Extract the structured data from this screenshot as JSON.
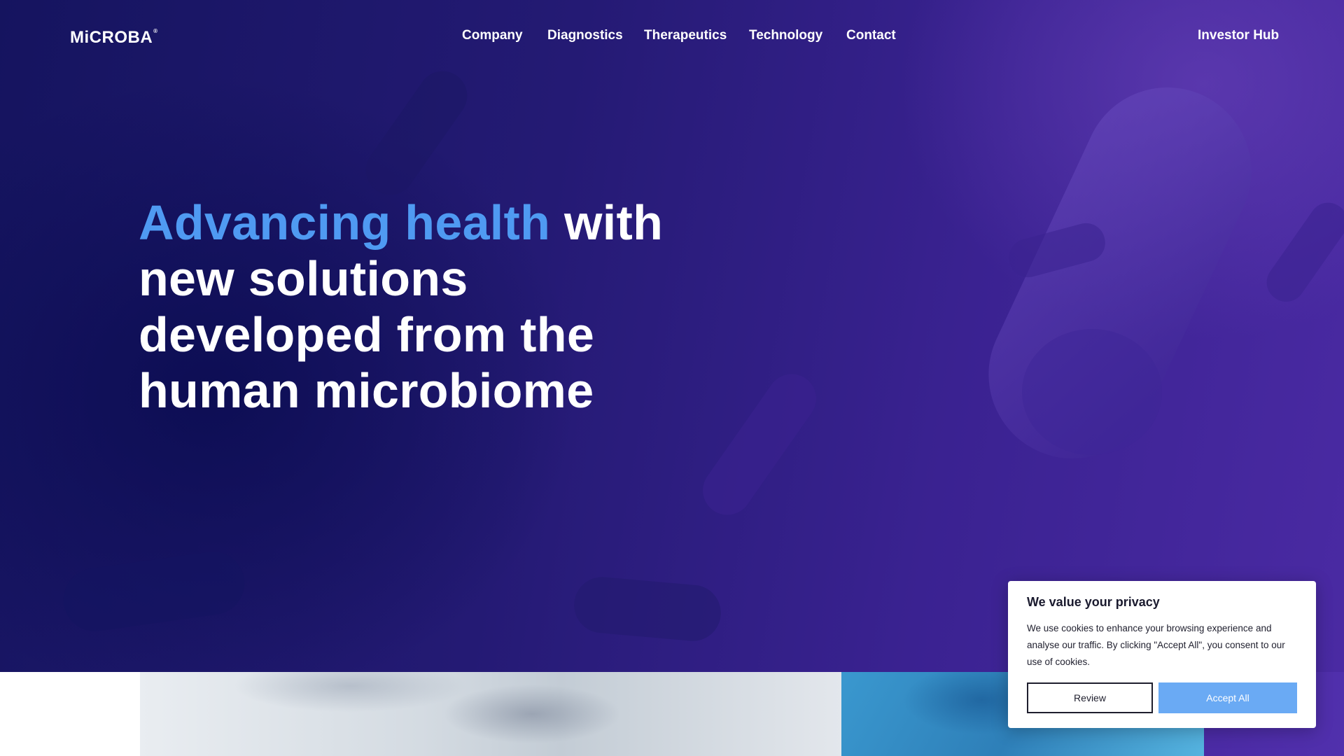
{
  "brand": {
    "logo_text": "MiCROBA",
    "logo_mark": "®"
  },
  "nav": {
    "items": [
      {
        "label": "Company"
      },
      {
        "label": "Diagnostics"
      },
      {
        "label": "Therapeutics"
      },
      {
        "label": "Technology"
      },
      {
        "label": "Contact"
      }
    ],
    "investor_hub": "Investor Hub"
  },
  "hero": {
    "headline_accent": "Advancing health",
    "headline_rest_1": " with",
    "headline_rest_2": "new solutions",
    "headline_rest_3": "developed from the",
    "headline_rest_4": "human microbiome"
  },
  "cookie_banner": {
    "title": "We value your privacy",
    "body": "We use cookies to enhance your browsing experience and analyse our traffic. By clicking \"Accept All\", you consent to our use of cookies.",
    "review_label": "Review",
    "accept_label": "Accept All"
  },
  "colors": {
    "hero_dark": "#15145f",
    "hero_light": "#4a2aa3",
    "accent_text": "#4f9af2",
    "accept_button": "#6aaaf4"
  }
}
